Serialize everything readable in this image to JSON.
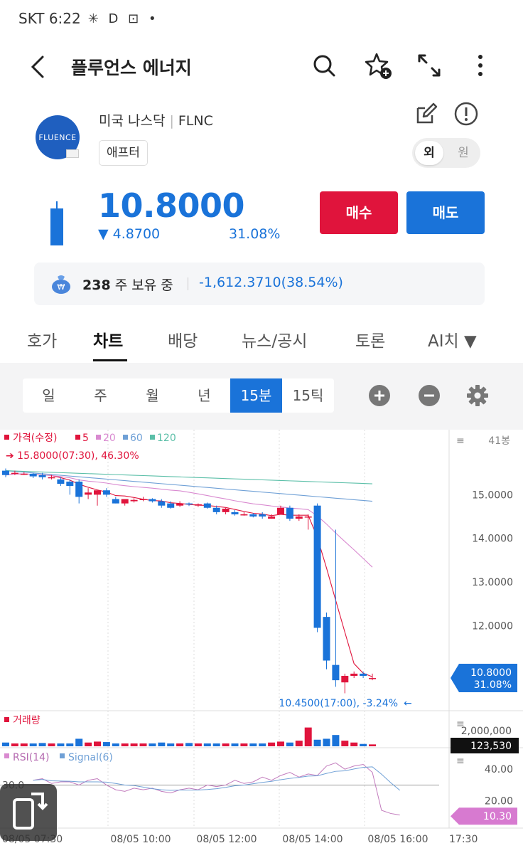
{
  "status": {
    "carrier_time": "SKT 6:22",
    "icons": "✳ D ⊡ •"
  },
  "header": {
    "title": "플루언스 에너지"
  },
  "stock": {
    "logo_text": "FLUENCE",
    "market": "미국 나스닥",
    "ticker": "FLNC",
    "session_badge": "애프터",
    "currency_toggle": {
      "selected": "외",
      "other": "원"
    },
    "price": "10.8000",
    "change": "▼ 4.8700",
    "change_pct": "31.08%",
    "buy_label": "매수",
    "sell_label": "매도"
  },
  "holding": {
    "qty": "238",
    "qty_suffix": "주 보유 중",
    "pl": "-1,612.3710",
    "pl_pct": "(38.54%)"
  },
  "tabs": [
    "호가",
    "차트",
    "배당",
    "뉴스/공시",
    "토론",
    "AI치 ▼"
  ],
  "periods": [
    "일",
    "주",
    "월",
    "년",
    "15분",
    "15틱"
  ],
  "colors": {
    "up": "#e0143c",
    "down": "#1a73d9",
    "accent": "#1a73d9"
  },
  "chart_data": {
    "type": "candlestick",
    "legend": {
      "price": "가격(수정)",
      "ma": [
        "5",
        "20",
        "60",
        "120"
      ],
      "ma_colors": [
        "#e0143c",
        "#d98ad0",
        "#6fa0d6",
        "#5bbfa8"
      ]
    },
    "bar_count_label": "41봉",
    "high_annotation": "15.8000(07:30), 46.30%",
    "low_annotation": "10.4500(17:00), -3.24%",
    "y_ticks": [
      "15.0000",
      "14.0000",
      "13.0000",
      "12.0000"
    ],
    "ylim": [
      10.1,
      16.0
    ],
    "current_label": {
      "price": "10.8000",
      "pct": "31.08%"
    },
    "candles": [
      {
        "o": 15.55,
        "c": 15.45,
        "h": 15.6,
        "l": 15.4
      },
      {
        "o": 15.5,
        "c": 15.5,
        "h": 15.55,
        "l": 15.45
      },
      {
        "o": 15.48,
        "c": 15.48,
        "h": 15.52,
        "l": 15.45
      },
      {
        "o": 15.48,
        "c": 15.42,
        "h": 15.5,
        "l": 15.38
      },
      {
        "o": 15.45,
        "c": 15.4,
        "h": 15.5,
        "l": 15.35
      },
      {
        "o": 15.4,
        "c": 15.4,
        "h": 15.45,
        "l": 15.35
      },
      {
        "o": 15.35,
        "c": 15.25,
        "h": 15.4,
        "l": 15.2
      },
      {
        "o": 15.3,
        "c": 15.2,
        "h": 15.35,
        "l": 15.0
      },
      {
        "o": 15.3,
        "c": 14.95,
        "h": 15.35,
        "l": 14.8
      },
      {
        "o": 15.0,
        "c": 15.05,
        "h": 15.15,
        "l": 14.9
      },
      {
        "o": 15.0,
        "c": 15.1,
        "h": 15.1,
        "l": 14.75
      },
      {
        "o": 15.1,
        "c": 15.0,
        "h": 15.15,
        "l": 14.95
      },
      {
        "o": 14.9,
        "c": 14.8,
        "h": 14.95,
        "l": 14.8
      },
      {
        "o": 14.8,
        "c": 14.9,
        "h": 14.9,
        "l": 14.75
      },
      {
        "o": 14.85,
        "c": 14.88,
        "h": 14.92,
        "l": 14.82
      },
      {
        "o": 14.9,
        "c": 14.9,
        "h": 14.95,
        "l": 14.85
      },
      {
        "o": 14.9,
        "c": 14.85,
        "h": 14.92,
        "l": 14.82
      },
      {
        "o": 14.85,
        "c": 14.75,
        "h": 14.9,
        "l": 14.7
      },
      {
        "o": 14.8,
        "c": 14.7,
        "h": 14.85,
        "l": 14.68
      },
      {
        "o": 14.75,
        "c": 14.8,
        "h": 14.85,
        "l": 14.72
      },
      {
        "o": 14.8,
        "c": 14.78,
        "h": 14.82,
        "l": 14.74
      },
      {
        "o": 14.75,
        "c": 14.78,
        "h": 14.8,
        "l": 14.72
      },
      {
        "o": 14.8,
        "c": 14.7,
        "h": 14.82,
        "l": 14.68
      },
      {
        "o": 14.7,
        "c": 14.6,
        "h": 14.75,
        "l": 14.55
      },
      {
        "o": 14.6,
        "c": 14.68,
        "h": 14.7,
        "l": 14.55
      },
      {
        "o": 14.6,
        "c": 14.55,
        "h": 14.65,
        "l": 14.52
      },
      {
        "o": 14.55,
        "c": 14.55,
        "h": 14.6,
        "l": 14.52
      },
      {
        "o": 14.55,
        "c": 14.5,
        "h": 14.58,
        "l": 14.48
      },
      {
        "o": 14.55,
        "c": 14.5,
        "h": 14.6,
        "l": 14.45
      },
      {
        "o": 14.45,
        "c": 14.5,
        "h": 14.55,
        "l": 14.45
      },
      {
        "o": 14.55,
        "c": 14.7,
        "h": 14.75,
        "l": 14.55
      },
      {
        "o": 14.7,
        "c": 14.45,
        "h": 14.75,
        "l": 14.4
      },
      {
        "o": 14.45,
        "c": 14.5,
        "h": 14.55,
        "l": 14.4
      },
      {
        "o": 14.5,
        "c": 14.5,
        "h": 14.55,
        "l": 14.2
      },
      {
        "o": 14.75,
        "c": 11.95,
        "h": 14.8,
        "l": 11.85
      },
      {
        "o": 12.2,
        "c": 11.2,
        "h": 12.3,
        "l": 11.0
      },
      {
        "o": 11.1,
        "c": 10.75,
        "h": 14.2,
        "l": 10.6
      },
      {
        "o": 10.7,
        "c": 10.85,
        "h": 10.9,
        "l": 10.45
      },
      {
        "o": 10.85,
        "c": 10.9,
        "h": 10.95,
        "l": 10.8
      },
      {
        "o": 10.9,
        "c": 10.85,
        "h": 10.95,
        "l": 10.8
      },
      {
        "o": 10.8,
        "c": 10.8,
        "h": 10.9,
        "l": 10.75
      }
    ],
    "volume_title": "거래량",
    "volume_ticks": [
      "2,000,000"
    ],
    "volume_current": "123,530",
    "volume": [
      8,
      6,
      6,
      6,
      7,
      6,
      6,
      6,
      16,
      8,
      10,
      9,
      6,
      6,
      6,
      6,
      6,
      8,
      6,
      6,
      7,
      6,
      6,
      6,
      6,
      6,
      6,
      6,
      6,
      8,
      10,
      8,
      12,
      40,
      14,
      16,
      24,
      12,
      8,
      5,
      4
    ],
    "rsi_title": "RSI(14)",
    "signal_title": "Signal(6)",
    "rsi_ticks": [
      "40.00",
      "20.00"
    ],
    "rsi_level": "30.0",
    "rsi_current": "10.30",
    "rsi": [
      33,
      34,
      31,
      32,
      32,
      30,
      33,
      34,
      30,
      27,
      26,
      28,
      27,
      28,
      26,
      25,
      27,
      28,
      27,
      30,
      29,
      30,
      33,
      31,
      32,
      35,
      33,
      36,
      38,
      35,
      37,
      36,
      42,
      44,
      40,
      42,
      43,
      38,
      14,
      12,
      11
    ],
    "x_ticks": [
      "08/05 07:30",
      "08/05 10:00",
      "08/05 12:00",
      "08/05 14:00",
      "08/05 16:00",
      "17:30"
    ]
  }
}
